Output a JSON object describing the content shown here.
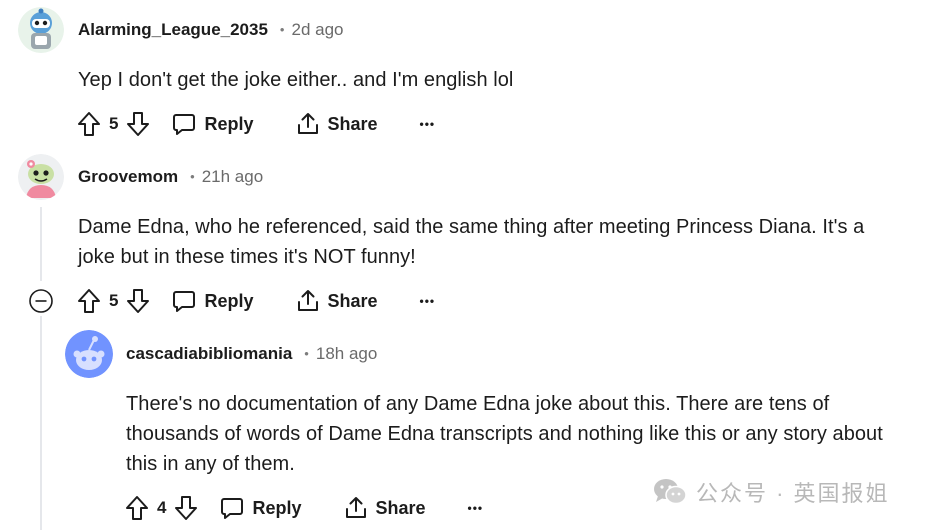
{
  "comments": [
    {
      "username": "Alarming_League_2035",
      "separator": "•",
      "time": "2d ago",
      "lines": [
        "Yep I don't get the joke either.. and I'm english lol"
      ],
      "votes": "5",
      "reply_label": "Reply",
      "share_label": "Share",
      "more_label": "•••"
    },
    {
      "username": "Groovemom",
      "separator": "•",
      "time": "21h ago",
      "lines": [
        "Dame Edna, who he referenced, said the same thing after meeting Princess Diana. It's a",
        "joke but in these times it's NOT funny!"
      ],
      "votes": "5",
      "reply_label": "Reply",
      "share_label": "Share",
      "more_label": "•••"
    },
    {
      "username": "cascadiabibliomania",
      "separator": "•",
      "time": "18h ago",
      "lines": [
        "There's no documentation of any Dame Edna joke about this. There are tens of",
        "thousands of words of Dame Edna transcripts and nothing like this or any story about",
        "this in any of them."
      ],
      "votes": "4",
      "reply_label": "Reply",
      "share_label": "Share",
      "more_label": "•••"
    }
  ],
  "watermark": {
    "text": "公众号 · 英国报姐",
    "icon": "wechat-icon"
  },
  "colors": {
    "text": "#1c1c1c",
    "meta": "#6a6a6a",
    "thread_line": "#e5e7eb",
    "avatar_blue": "#7193ff",
    "watermark": "#b8b8b8"
  }
}
